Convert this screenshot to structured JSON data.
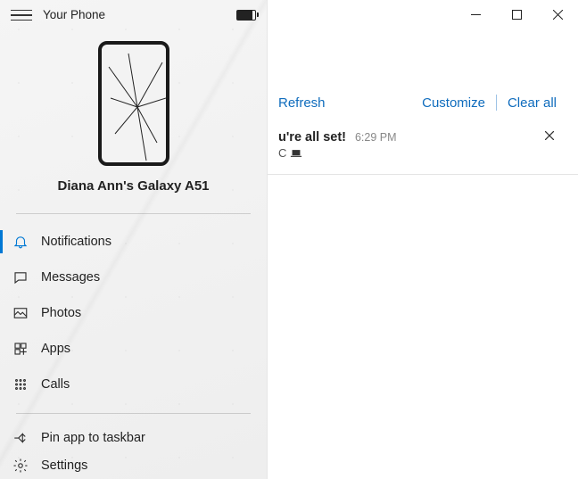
{
  "app": {
    "title": "Your Phone"
  },
  "device": {
    "name": "Diana Ann's Galaxy A51"
  },
  "nav": {
    "notifications": "Notifications",
    "messages": "Messages",
    "photos": "Photos",
    "apps": "Apps",
    "calls": "Calls"
  },
  "footer": {
    "pin": "Pin app to taskbar",
    "settings": "Settings"
  },
  "actions": {
    "refresh": "Refresh",
    "customize": "Customize",
    "clear_all": "Clear all"
  },
  "notification": {
    "title": "u're all set!",
    "time": "6:29 PM",
    "subtitle": "C"
  }
}
